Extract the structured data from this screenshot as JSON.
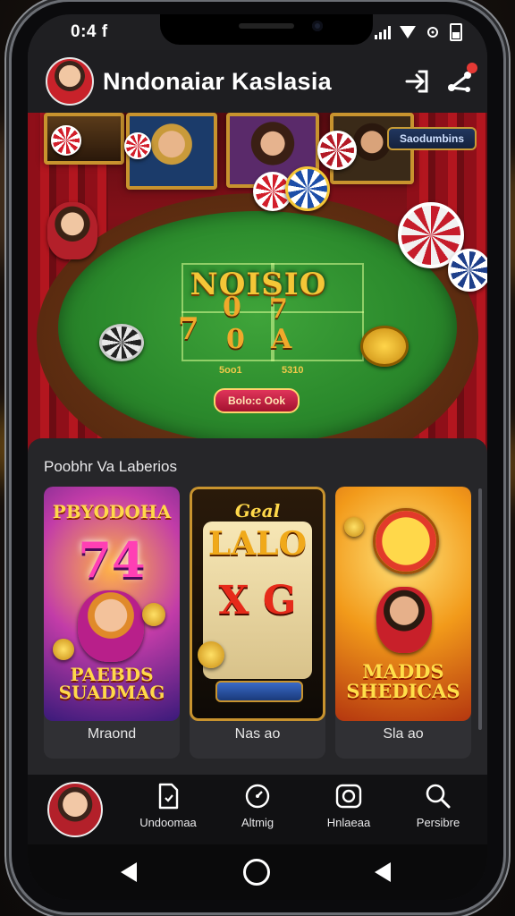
{
  "status_bar": {
    "time": "0:4 f"
  },
  "header": {
    "title": "Nndonaiar Kaslasia",
    "notification_count": ""
  },
  "hero": {
    "badge": "Saodumbins",
    "felt_logo": "NOISIO",
    "felt_symbols": [
      "7",
      "0",
      "7",
      "0",
      "A"
    ],
    "felt_small": [
      "5oo1",
      "5310"
    ],
    "felt_button": "Bolo:c Ook"
  },
  "featured": {
    "title": "Poobhr Va Laberios",
    "cards": [
      {
        "label": "Mraond",
        "art_title": "PBYODOHA",
        "art_number": "74",
        "art_footer": "PAEBDS SUADMAG"
      },
      {
        "label": "Nas ao",
        "art_title": "Geal",
        "art_number": "LALO",
        "art_footer": "X G"
      },
      {
        "label": "Sla ao",
        "art_title": "",
        "art_number": "",
        "art_footer": "MADDS SHEDICAS"
      }
    ]
  },
  "bottom_nav": {
    "items": [
      {
        "label": "Undoomaa",
        "icon": "file-icon"
      },
      {
        "label": "Altmig",
        "icon": "clock-icon"
      },
      {
        "label": "Hnlaeaa",
        "icon": "camera-icon"
      },
      {
        "label": "Persibre",
        "icon": "search-icon"
      }
    ]
  },
  "colors": {
    "accent_gold": "#f4c637",
    "felt_green": "#2b8a2c",
    "curtain_red": "#8f0f19",
    "panel_bg": "#262629"
  }
}
